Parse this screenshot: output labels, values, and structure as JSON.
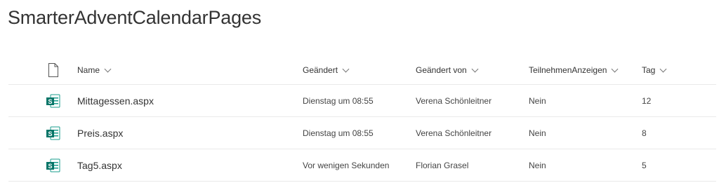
{
  "page_title": "SmarterAdventCalendarPages",
  "columns": {
    "type_icon": "document-icon",
    "name": "Name",
    "modified": "Geändert",
    "modified_by": "Geändert von",
    "participate": "TeilnehmenAnzeigen",
    "tag": "Tag"
  },
  "rows": [
    {
      "icon": "sharepoint-page-icon",
      "name": "Mittagessen.aspx",
      "modified": "Dienstag um 08:55",
      "modified_by": "Verena Schönleitner",
      "participate": "Nein",
      "tag": "12"
    },
    {
      "icon": "sharepoint-page-icon",
      "name": "Preis.aspx",
      "modified": "Dienstag um 08:55",
      "modified_by": "Verena Schönleitner",
      "participate": "Nein",
      "tag": "8"
    },
    {
      "icon": "sharepoint-page-icon",
      "name": "Tag5.aspx",
      "modified": "Vor wenigen Sekunden",
      "modified_by": "Florian Grasel",
      "participate": "Nein",
      "tag": "5"
    }
  ],
  "colors": {
    "icon_teal": "#077568",
    "icon_teal_light": "#1a9c8c",
    "divider": "#eaeaea"
  }
}
